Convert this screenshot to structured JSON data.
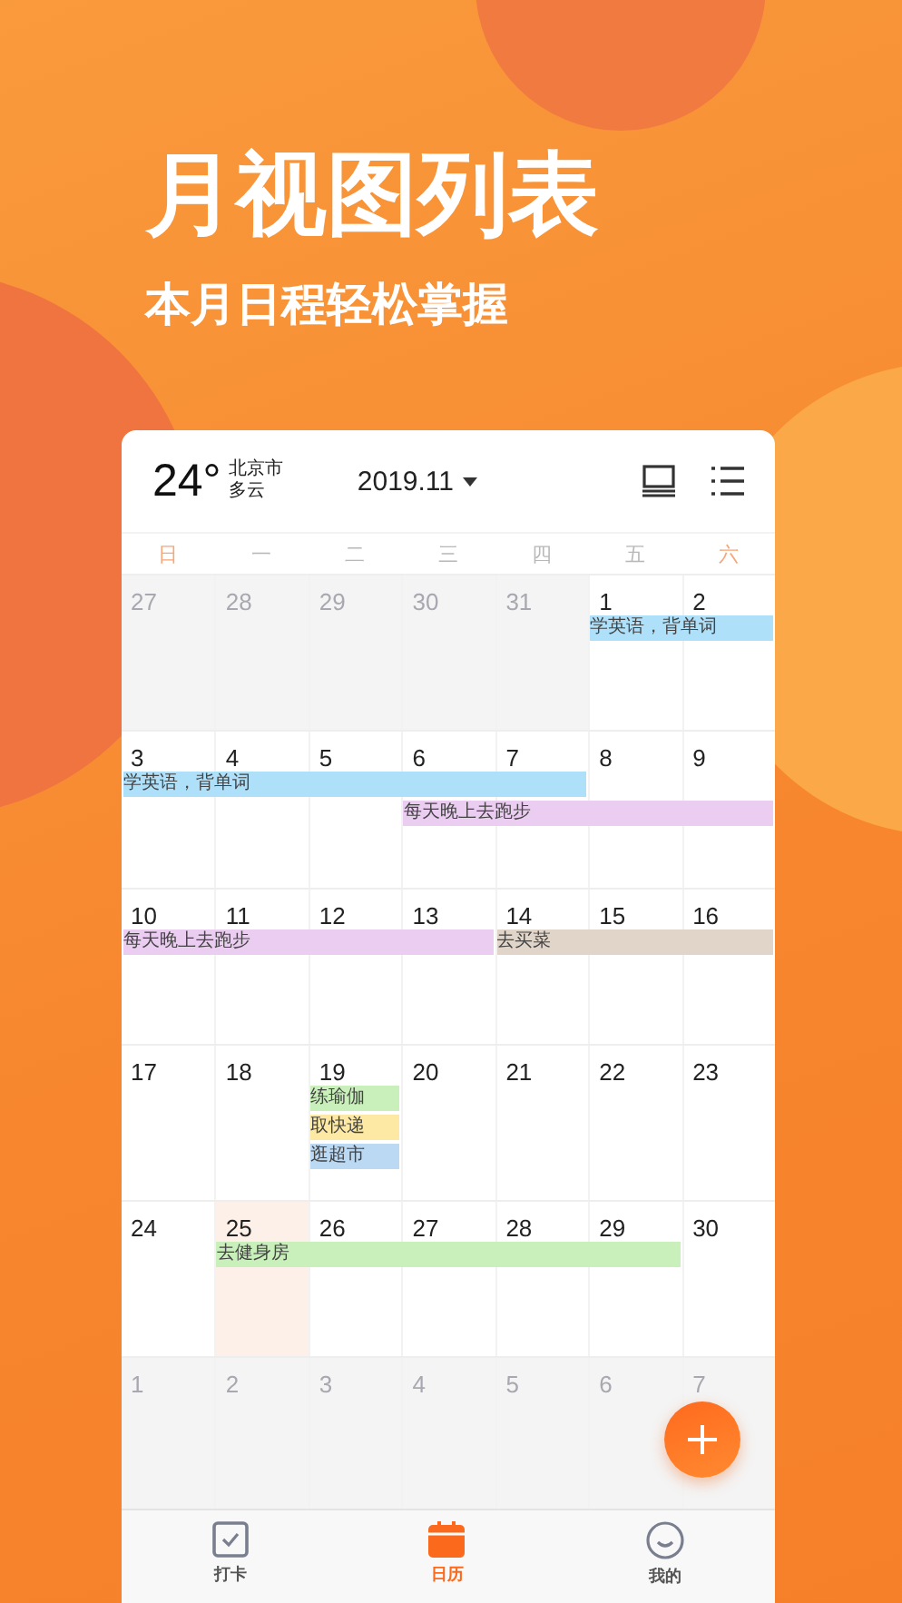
{
  "promo": {
    "title": "月视图列表",
    "subtitle": "本月日程轻松掌握"
  },
  "header": {
    "temperature": "24°",
    "city": "北京市",
    "weather": "多云",
    "month": "2019.11"
  },
  "weekdays": [
    {
      "label": "日",
      "weekend": true
    },
    {
      "label": "一",
      "weekend": false
    },
    {
      "label": "二",
      "weekend": false
    },
    {
      "label": "三",
      "weekend": false
    },
    {
      "label": "四",
      "weekend": false
    },
    {
      "label": "五",
      "weekend": false
    },
    {
      "label": "六",
      "weekend": true
    }
  ],
  "weeks": [
    {
      "days": [
        {
          "label": "27",
          "muted": true,
          "selected": false
        },
        {
          "label": "28",
          "muted": true,
          "selected": false
        },
        {
          "label": "29",
          "muted": true,
          "selected": false
        },
        {
          "label": "30",
          "muted": true,
          "selected": false
        },
        {
          "label": "31",
          "muted": true,
          "selected": false
        },
        {
          "label": "1",
          "muted": false,
          "selected": false
        },
        {
          "label": "2",
          "muted": false,
          "selected": false
        }
      ],
      "lanes": [
        [
          {
            "kind": "empty"
          },
          {
            "kind": "empty"
          },
          {
            "kind": "empty"
          },
          {
            "kind": "empty"
          },
          {
            "kind": "empty"
          },
          {
            "kind": "start",
            "text": "学英语，背单词",
            "color": "#aee0fa"
          },
          {
            "kind": "more"
          }
        ]
      ]
    },
    {
      "days": [
        {
          "label": "3",
          "muted": false,
          "selected": false
        },
        {
          "label": "4",
          "muted": false,
          "selected": false
        },
        {
          "label": "5",
          "muted": false,
          "selected": false
        },
        {
          "label": "6",
          "muted": false,
          "selected": false
        },
        {
          "label": "7",
          "muted": false,
          "selected": false
        },
        {
          "label": "8",
          "muted": false,
          "selected": false
        },
        {
          "label": "9",
          "muted": false,
          "selected": false
        }
      ],
      "lanes": [
        [
          {
            "kind": "start",
            "text": "学英语，背单词",
            "color": "#aee0fa"
          },
          {
            "kind": "more"
          },
          {
            "kind": "more"
          },
          {
            "kind": "more"
          },
          {
            "kind": "more"
          },
          {
            "kind": "empty"
          },
          {
            "kind": "empty"
          }
        ],
        [
          {
            "kind": "empty"
          },
          {
            "kind": "empty"
          },
          {
            "kind": "empty"
          },
          {
            "kind": "start",
            "text": "每天晚上去跑步",
            "color": "#eccdf2"
          },
          {
            "kind": "more"
          },
          {
            "kind": "more"
          },
          {
            "kind": "more"
          }
        ]
      ]
    },
    {
      "days": [
        {
          "label": "10",
          "muted": false,
          "selected": false
        },
        {
          "label": "11",
          "muted": false,
          "selected": false
        },
        {
          "label": "12",
          "muted": false,
          "selected": false
        },
        {
          "label": "13",
          "muted": false,
          "selected": false
        },
        {
          "label": "14",
          "muted": false,
          "selected": false
        },
        {
          "label": "15",
          "muted": false,
          "selected": false
        },
        {
          "label": "16",
          "muted": false,
          "selected": false
        }
      ],
      "lanes": [
        [
          {
            "kind": "start",
            "text": "每天晚上去跑步",
            "color": "#eccdf2"
          },
          {
            "kind": "more"
          },
          {
            "kind": "more"
          },
          {
            "kind": "more"
          },
          {
            "kind": "start",
            "text": "去买菜",
            "color": "#e1d5c9"
          },
          {
            "kind": "more"
          },
          {
            "kind": "more"
          }
        ]
      ]
    },
    {
      "days": [
        {
          "label": "17",
          "muted": false,
          "selected": false
        },
        {
          "label": "18",
          "muted": false,
          "selected": false
        },
        {
          "label": "19",
          "muted": false,
          "selected": false
        },
        {
          "label": "20",
          "muted": false,
          "selected": false
        },
        {
          "label": "21",
          "muted": false,
          "selected": false
        },
        {
          "label": "22",
          "muted": false,
          "selected": false
        },
        {
          "label": "23",
          "muted": false,
          "selected": false
        }
      ],
      "lanes": [
        [
          {
            "kind": "empty"
          },
          {
            "kind": "empty"
          },
          {
            "kind": "start",
            "text": "练瑜伽",
            "color": "#c9f0bb"
          },
          {
            "kind": "empty"
          },
          {
            "kind": "empty"
          },
          {
            "kind": "empty"
          },
          {
            "kind": "empty"
          }
        ],
        [
          {
            "kind": "empty"
          },
          {
            "kind": "empty"
          },
          {
            "kind": "start",
            "text": "取快递",
            "color": "#fde9a3"
          },
          {
            "kind": "empty"
          },
          {
            "kind": "empty"
          },
          {
            "kind": "empty"
          },
          {
            "kind": "empty"
          }
        ],
        [
          {
            "kind": "empty"
          },
          {
            "kind": "empty"
          },
          {
            "kind": "start",
            "text": "逛超市",
            "color": "#bcd9f3"
          },
          {
            "kind": "empty"
          },
          {
            "kind": "empty"
          },
          {
            "kind": "empty"
          },
          {
            "kind": "empty"
          }
        ]
      ]
    },
    {
      "days": [
        {
          "label": "24",
          "muted": false,
          "selected": false
        },
        {
          "label": "25",
          "muted": false,
          "selected": true
        },
        {
          "label": "26",
          "muted": false,
          "selected": false
        },
        {
          "label": "27",
          "muted": false,
          "selected": false
        },
        {
          "label": "28",
          "muted": false,
          "selected": false
        },
        {
          "label": "29",
          "muted": false,
          "selected": false
        },
        {
          "label": "30",
          "muted": false,
          "selected": false
        }
      ],
      "lanes": [
        [
          {
            "kind": "empty"
          },
          {
            "kind": "start",
            "text": "去健身房",
            "color": "#c9f0bb"
          },
          {
            "kind": "more"
          },
          {
            "kind": "more"
          },
          {
            "kind": "more"
          },
          {
            "kind": "more"
          },
          {
            "kind": "empty"
          }
        ]
      ]
    },
    {
      "days": [
        {
          "label": "1",
          "muted": true,
          "selected": false
        },
        {
          "label": "2",
          "muted": true,
          "selected": false
        },
        {
          "label": "3",
          "muted": true,
          "selected": false
        },
        {
          "label": "4",
          "muted": true,
          "selected": false
        },
        {
          "label": "5",
          "muted": true,
          "selected": false
        },
        {
          "label": "6",
          "muted": true,
          "selected": false
        },
        {
          "label": "7",
          "muted": true,
          "selected": false
        }
      ]
    }
  ],
  "tabs": [
    {
      "label": "打卡",
      "kind": "checkin",
      "selected": false
    },
    {
      "label": "日历",
      "kind": "calendar",
      "selected": true
    },
    {
      "label": "我的",
      "kind": "profile",
      "selected": false
    }
  ]
}
